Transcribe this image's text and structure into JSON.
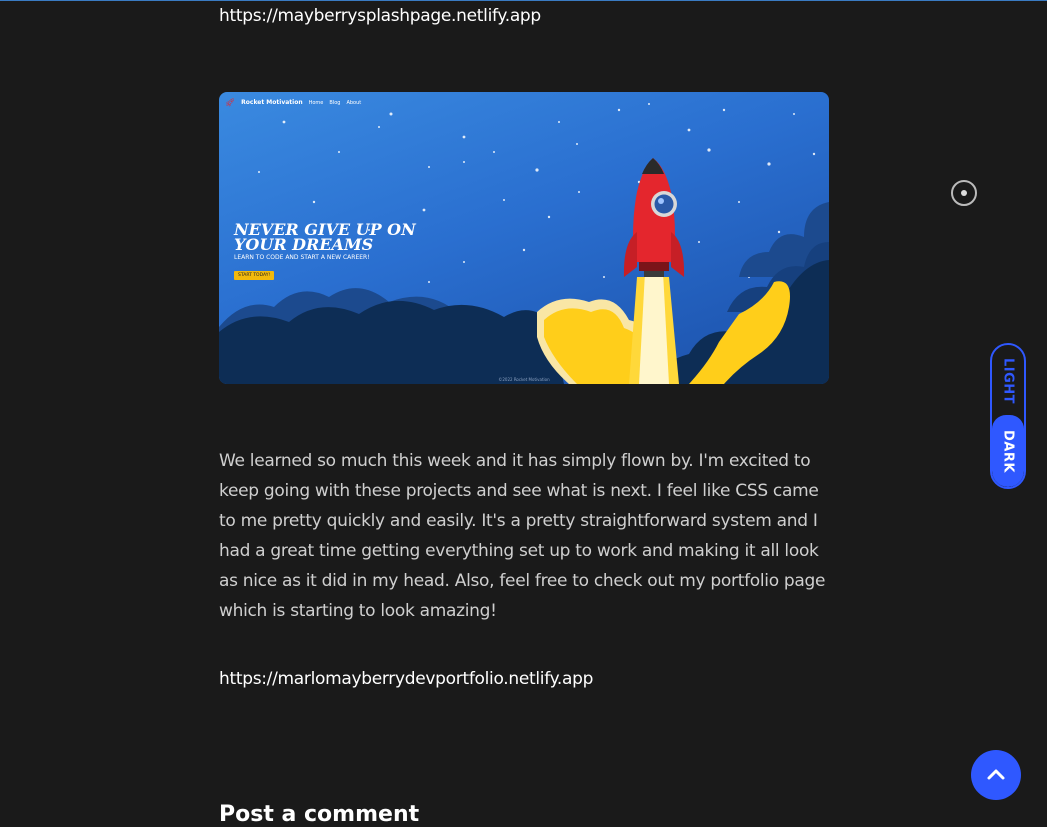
{
  "links": {
    "splash_url": "https://mayberrysplashpage.netlify.app",
    "portfolio_url": "https://marlomayberrydevportfolio.netlify.app"
  },
  "screenshot": {
    "logo_text": "Rocket Motivation",
    "nav": [
      "Home",
      "Blog",
      "About"
    ],
    "hero_title": "NEVER GIVE UP ON YOUR DREAMS",
    "hero_subtitle": "LEARN TO CODE AND START A NEW CAREER!",
    "cta_label": "START TODAY!",
    "footer_text": "©2022 Rocket Motivation"
  },
  "post": {
    "paragraph": "We learned so much this week and it has simply flown by. I'm excited to keep going with these projects and see what is next. I feel like CSS came to me pretty quickly and easily. It's a pretty straightforward system and I had a great time getting everything set up to work and making it all look as nice as it did in my head. Also, feel free to check out my portfolio page which is starting to look amazing!"
  },
  "comments": {
    "title": "Post a comment"
  },
  "theme_toggle": {
    "light_label": "LIGHT",
    "dark_label": "DARK",
    "selected": "DARK"
  },
  "icons": {
    "radio": "radio-dot-icon",
    "scroll_top": "chevron-up-icon"
  },
  "colors": {
    "background": "#1a1a1a",
    "accent": "#2f58ff",
    "text": "#cfcfcf",
    "cta": "#f2b90c"
  }
}
